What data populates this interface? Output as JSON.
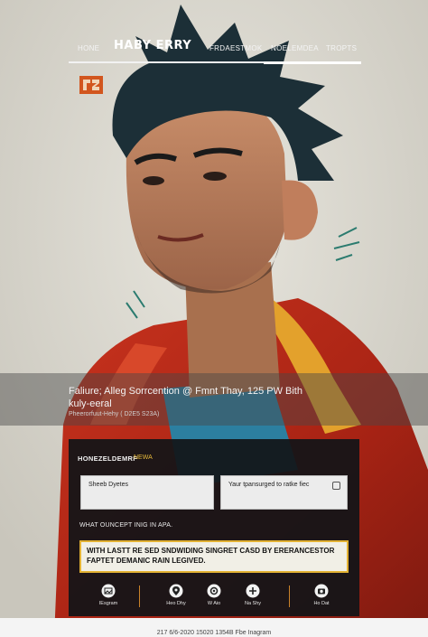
{
  "nav": {
    "brand": "HABY ERRY",
    "items": [
      "HONE",
      "FRDAESTMOK",
      "NOELEMDEA",
      "TROPTS"
    ]
  },
  "hero": {
    "caption_title": "Faliure; Alleg Sorrcention @ Fmnt Thay, 125 PW Bith",
    "caption_sub": "kuly-eeral",
    "caption_meta": "Pheerorfuut-Hehy ( D2E5 S23A)"
  },
  "panel": {
    "title": "HONEZELDEMRF",
    "tag": "NEWA",
    "field_left_value": "Sheeb Dyetes",
    "field_right_value": "Yaur tpansurged to ratke fiec",
    "section_label": "WHAT OUNCEPT INIG IN APA.",
    "callout_text": "WITH LASTT RE SED SNDWIDING SINGRET CASD BY ERERANCESTOR FAPTET DEMANIC RAIN LEGIVED."
  },
  "actions": [
    {
      "label": "IEsgram",
      "icon": "image-icon"
    },
    {
      "label": "Heo Dhy",
      "icon": "map-marker-icon"
    },
    {
      "label": "W Aio",
      "icon": "settings-icon"
    },
    {
      "label": "Na Shy",
      "icon": "plus-icon"
    },
    {
      "label": "Ho Dat",
      "icon": "camera-icon"
    }
  ],
  "footer": {
    "text": "217 6/6-2020 15020 1354B Fbe Inagram"
  },
  "colors": {
    "accent": "#e3b233",
    "panel_bg": "#121418",
    "logo": "#d2561e"
  }
}
